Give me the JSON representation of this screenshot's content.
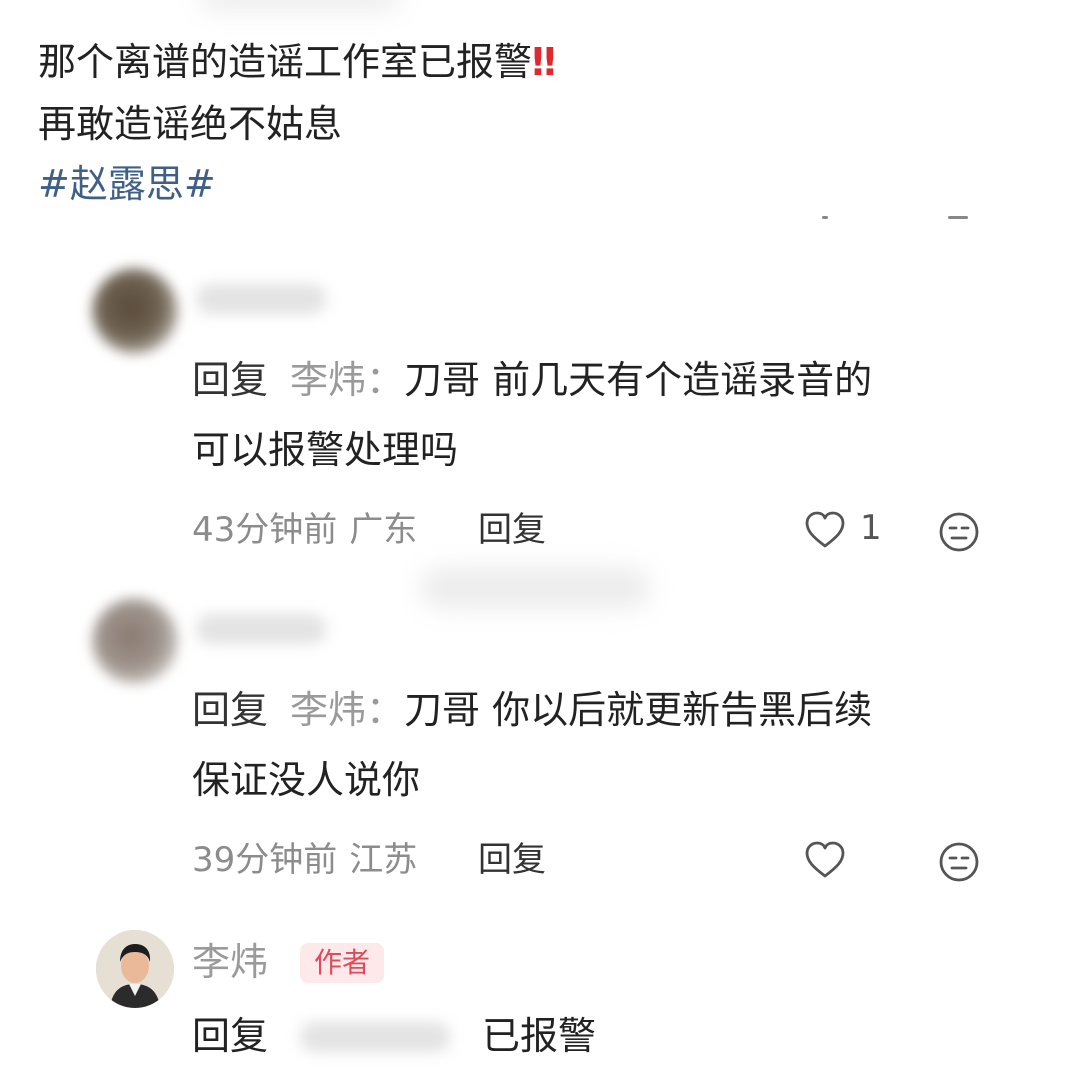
{
  "post": {
    "line1": "那个离谱的造谣工作室已报警",
    "alert": "‼",
    "line2": "再敢造谣绝不姑息",
    "hashtag": "#赵露思#"
  },
  "comments": [
    {
      "reply_label": "回复",
      "reply_to": "李炜：",
      "text_line1": "刀哥 前几天有个造谣录音的",
      "text_line2": "可以报警处理吗",
      "time": "43分钟前",
      "location": "广东",
      "reply_action": "回复",
      "like_count": "1"
    },
    {
      "reply_label": "回复",
      "reply_to": "李炜：",
      "text_line1": "刀哥 你以后就更新告黑后续",
      "text_line2": "保证没人说你",
      "time": "39分钟前",
      "location": "江苏",
      "reply_action": "回复",
      "like_count": ""
    }
  ],
  "author_comment": {
    "name": "李炜",
    "badge": "作者",
    "reply_label": "回复",
    "text": "已报警"
  },
  "icons": {
    "like": "heart-outline-icon",
    "dislike": "neutral-face-icon"
  },
  "colors": {
    "hashtag": "#3f5f86",
    "alert": "#e0292f",
    "badge_bg": "#fde8ea",
    "badge_text": "#e14a5a"
  }
}
